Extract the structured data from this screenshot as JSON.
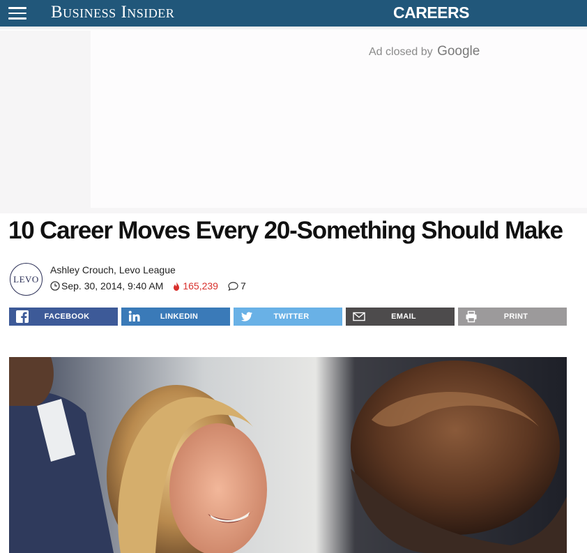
{
  "header": {
    "brand": "Business Insider",
    "section": "CAREERS",
    "menu_icon": "hamburger-menu-icon"
  },
  "ad": {
    "closed_text": "Ad closed by",
    "provider": "Google"
  },
  "article": {
    "headline": "10 Career Moves Every 20-Something Should Make",
    "author": "Ashley Crouch, Levo League",
    "publisher_logo_text": "LEVO",
    "date": "Sep. 30, 2014, 9:40 AM",
    "views": "165,239",
    "comments": "7"
  },
  "share": {
    "buttons": [
      {
        "label": "FACEBOOK",
        "icon": "facebook-icon",
        "color": "#3d5a98"
      },
      {
        "label": "LINKEDIN",
        "icon": "linkedin-icon",
        "color": "#3a7ab8"
      },
      {
        "label": "TWITTER",
        "icon": "twitter-icon",
        "color": "#69b1e6"
      },
      {
        "label": "EMAIL",
        "icon": "envelope-icon",
        "color": "#4d4b4c"
      },
      {
        "label": "PRINT",
        "icon": "printer-icon",
        "color": "#9c9a9b"
      }
    ]
  },
  "colors": {
    "header_bg": "#21577a",
    "views_red": "#d8302c"
  }
}
